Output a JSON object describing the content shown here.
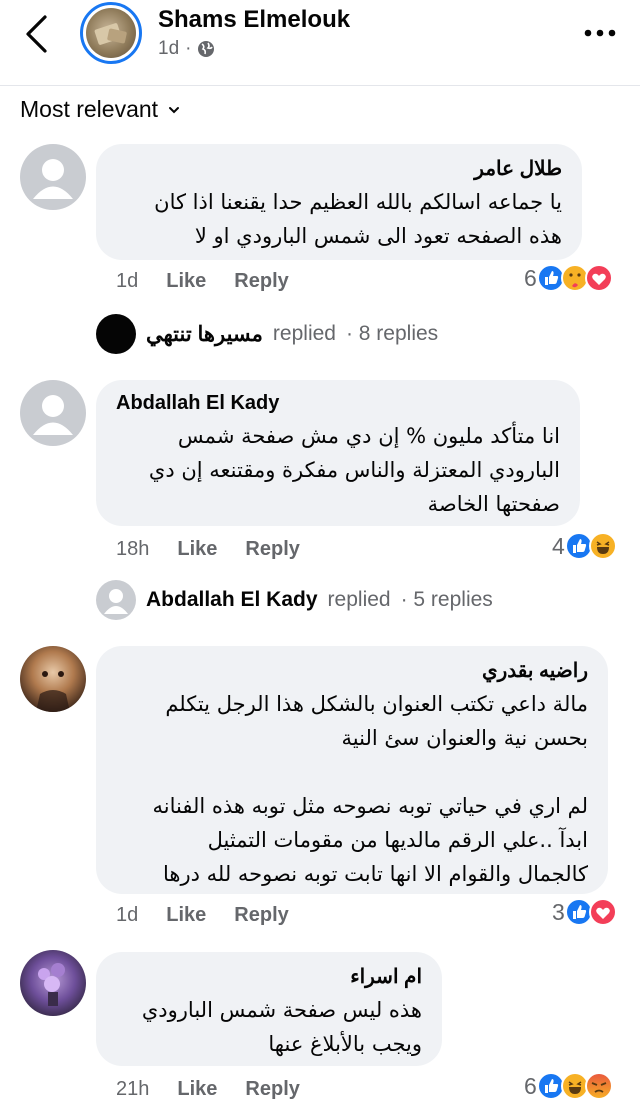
{
  "header": {
    "page_name": "Shams Elmelouk",
    "time": "1d",
    "separator": "·"
  },
  "sort": {
    "label": "Most relevant"
  },
  "comments": [
    {
      "author": "طلال عامر",
      "text": "يا جماعه اسالكم بالله العظيم حدا يقنعنا اذا كان\nهذه الصفحه تعود الى شمس البارودي او لا",
      "time": "1d",
      "like": "Like",
      "reply": "Reply",
      "reaction_count": "6",
      "replies": {
        "who": "مسيرها تنتهي",
        "verb": "replied",
        "count": "· 8 replies"
      }
    },
    {
      "author": "Abdallah El Kady",
      "text": "انا متأكد مليون % إن دي مش صفحة شمس\nالبارودي المعتزلة والناس مفكرة ومقتنعه إن دي\nصفحتها الخاصة",
      "time": "18h",
      "like": "Like",
      "reply": "Reply",
      "reaction_count": "4",
      "replies": {
        "who": "Abdallah El Kady",
        "verb": "replied",
        "count": "· 5 replies"
      }
    },
    {
      "author": "راضيه بقدري",
      "text": "مالة داعي تكتب العنوان بالشكل هذا الرجل يتكلم\nبحسن نية والعنوان سئ النية\n\nلم اري في حياتي توبه نصوحه مثل توبه هذه الفنانه\nابدآ ..علي الرقم مالديها من مقومات التمثيل\nكالجمال والقوام الا انها تابت توبه نصوحه لله درها",
      "time": "1d",
      "like": "Like",
      "reply": "Reply",
      "reaction_count": "3"
    },
    {
      "author": "ام اسراء",
      "text": "هذه ليس صفحة شمس البارودي\nويجب بالأبلاغ عنها",
      "time": "21h",
      "like": "Like",
      "reply": "Reply",
      "reaction_count": "6"
    }
  ],
  "icons": {
    "back": "chevron-left-icon",
    "globe": "globe-icon",
    "more": "more-horizontal-icon",
    "sort": "chevron-down-icon",
    "like_reaction": "like-reaction-icon",
    "care_reaction": "care-reaction-icon",
    "love_reaction": "love-reaction-icon",
    "haha_reaction": "haha-reaction-icon",
    "angry_reaction": "angry-reaction-icon"
  },
  "colors": {
    "accent": "#1877f2",
    "love": "#f33e58",
    "secondary_text": "#65676b",
    "bubble": "#f0f2f5"
  }
}
